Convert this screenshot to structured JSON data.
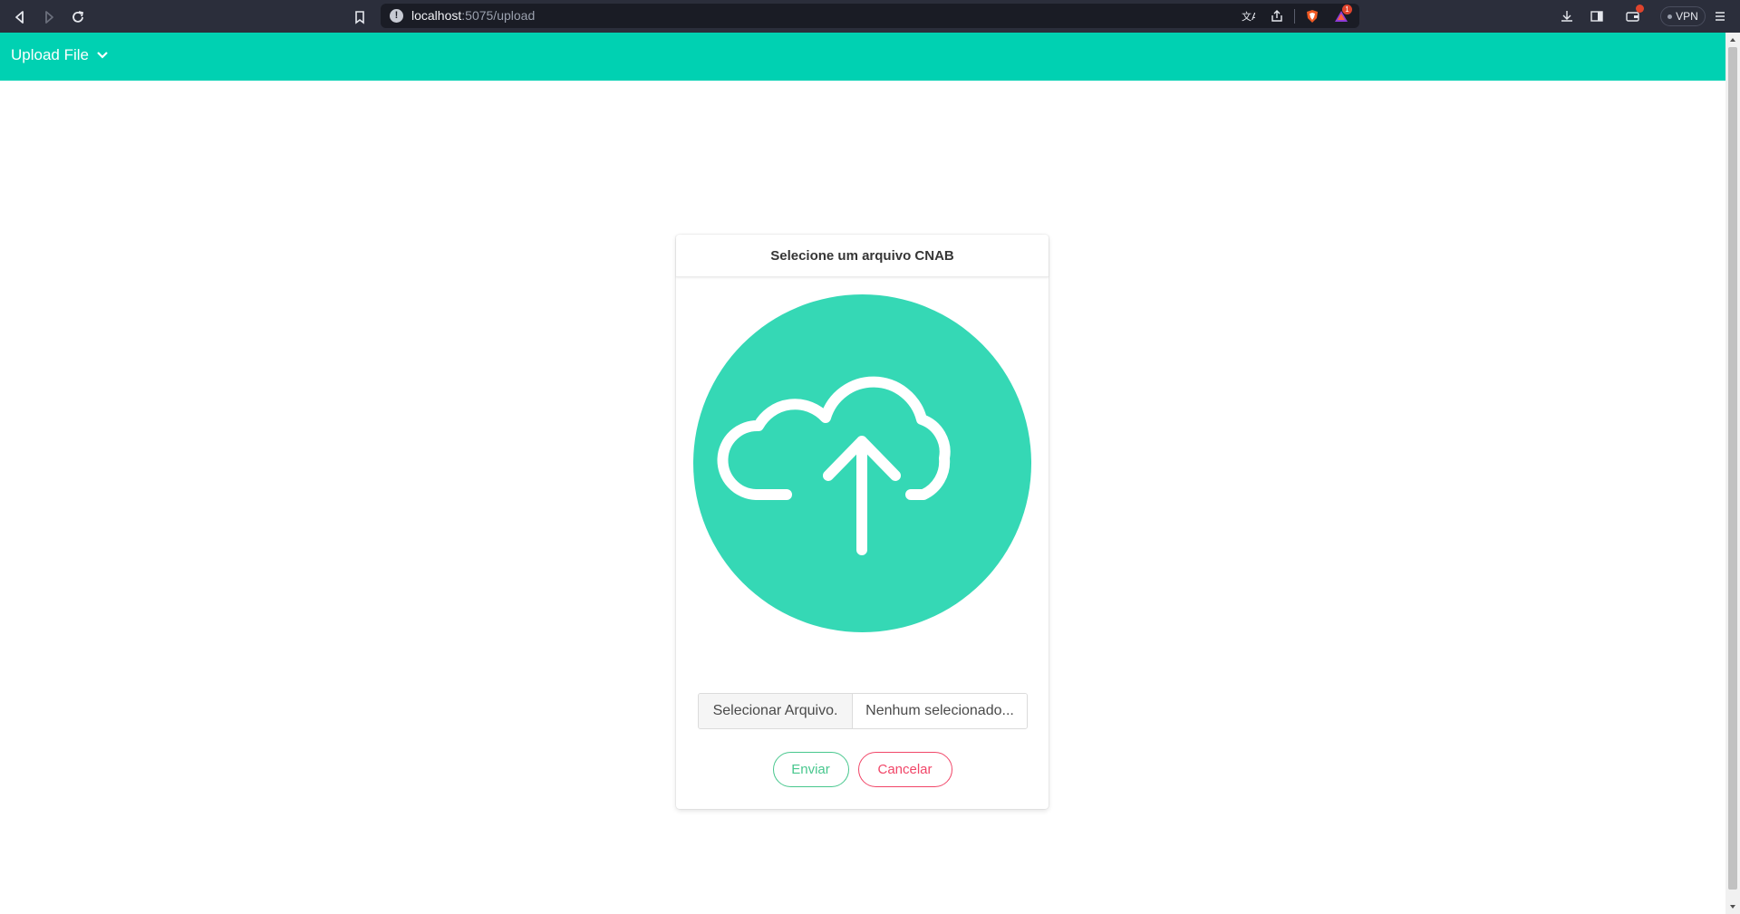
{
  "browser": {
    "url_host": "localhost",
    "url_path": ":5075/upload",
    "vpn_label": "VPN",
    "notification_count": "1",
    "icons": [
      "back-icon",
      "forward-icon",
      "reload-icon",
      "bookmark-icon",
      "info-icon",
      "translate-icon",
      "share-icon",
      "brave-shield-icon",
      "brave-rewards-icon",
      "download-icon",
      "sidebar-icon",
      "wallet-icon",
      "menu-icon"
    ]
  },
  "navbar": {
    "dropdown_label": "Upload File",
    "background": "#00d1b2"
  },
  "card": {
    "title": "Selecione um arquivo CNAB",
    "icon": "cloud-upload-icon",
    "icon_background": "#35d8b5",
    "file_button_label": "Selecionar Arquivo.",
    "file_name_placeholder": "Nenhum selecionado...",
    "send_label": "Enviar",
    "cancel_label": "Cancelar",
    "send_color": "#48c78e",
    "cancel_color": "#f14668"
  }
}
